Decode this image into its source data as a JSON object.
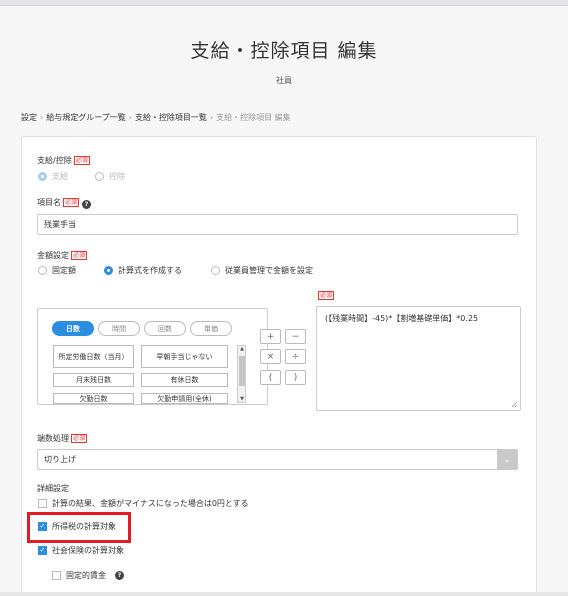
{
  "header": {
    "title": "支給・控除項目 編集",
    "subtitle": "社員"
  },
  "breadcrumb": {
    "items": [
      "設定",
      "給与規定グループ一覧",
      "支給・控除項目一覧"
    ],
    "current": "支給・控除項目 編集",
    "separator": "›"
  },
  "form": {
    "required_label": "必須",
    "type_section": {
      "label": "支給/控除",
      "options": [
        "支給",
        "控除"
      ],
      "selected": "支給"
    },
    "name_section": {
      "label": "項目名",
      "value": "残業手当"
    },
    "amount_section": {
      "label": "金額設定",
      "options": [
        "固定額",
        "計算式を作成する",
        "従業員管理で金額を設定"
      ],
      "selected": "計算式を作成する"
    },
    "calc": {
      "tabs": [
        "日数",
        "時間",
        "回数",
        "単価"
      ],
      "active_tab": "日数",
      "items": [
        "所定労働日数（当月）",
        "早朝手当じゃない",
        "月末残日数",
        "有休日数",
        "欠勤日数",
        "欠勤申請用(全休)"
      ],
      "operators": [
        "+",
        "−",
        "×",
        "÷",
        "(",
        ")"
      ],
      "formula_required_label": "必須",
      "formula": "(【残業時間】-45)*【割増基礎単価】*0.25"
    },
    "rounding_section": {
      "label": "端数処理",
      "value": "切り上げ"
    },
    "detail_section": {
      "label": "詳細設定",
      "checks": [
        {
          "label": "計算の結果、金額がマイナスになった場合は0円とする",
          "checked": false
        },
        {
          "label": "所得税の計算対象",
          "checked": true
        },
        {
          "label": "社会保険の計算対象",
          "checked": true
        },
        {
          "label": "固定的賃金",
          "checked": false
        }
      ]
    }
  },
  "colors": {
    "accent": "#2b8ee0",
    "required": "#e33333",
    "highlight": "#e41b23"
  }
}
